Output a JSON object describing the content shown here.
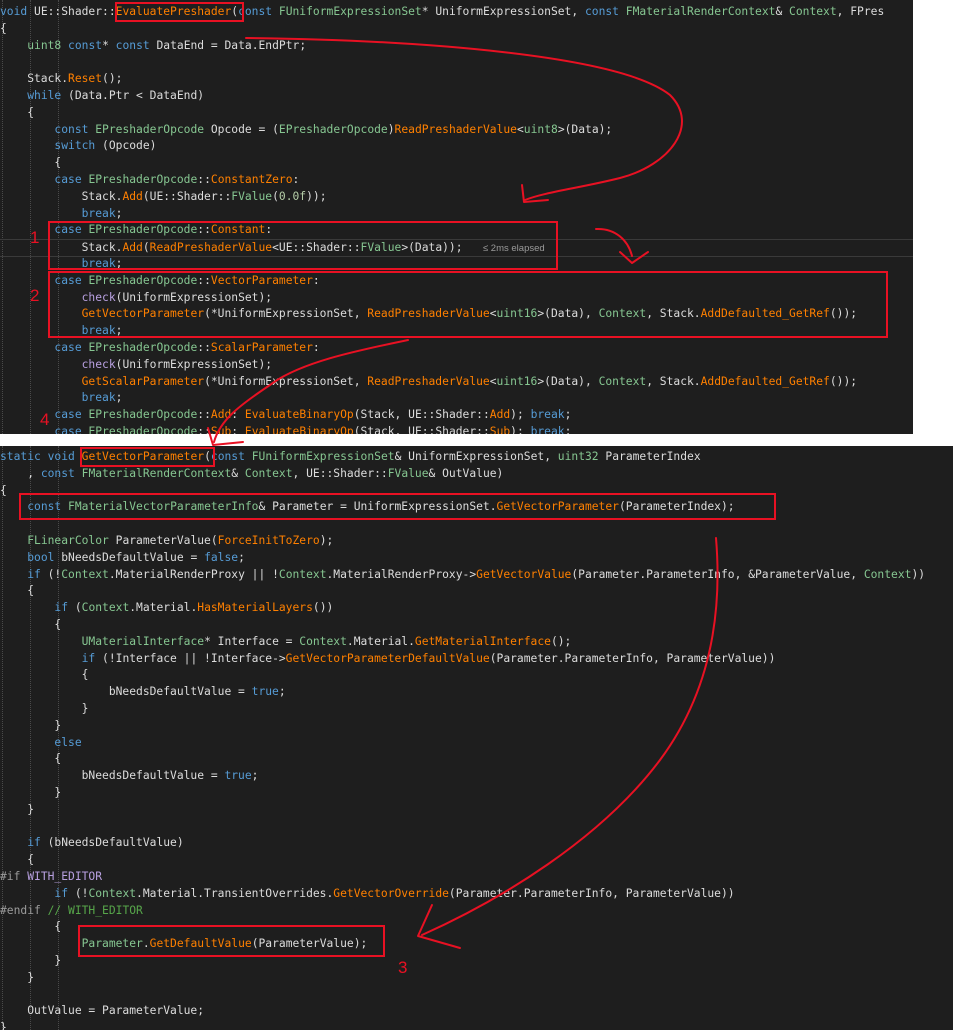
{
  "colors": {
    "default": "#dcdcdc",
    "keyword": "#569cd6",
    "type": "#4ec9b0",
    "struct": "#86c691",
    "func": "#ff8000",
    "macro": "#b8a0e0",
    "numeric": "#b5cea8",
    "comment": "#57a64a",
    "prep": "#9b9b9b",
    "param": "#9a9a9a",
    "annotation": "#e81123"
  },
  "top_editor": {
    "elapsed_hint": "≤ 2ms elapsed",
    "lines": [
      [
        [
          "void",
          "keyword"
        ],
        [
          " UE::Shader::",
          "default"
        ],
        [
          "EvaluatePreshader",
          "func"
        ],
        [
          "(",
          "default"
        ],
        [
          "const",
          "keyword"
        ],
        [
          " ",
          "default"
        ],
        [
          "FUniformExpressionSet",
          "struct"
        ],
        [
          "* UniformExpressionSet, ",
          "default"
        ],
        [
          "const",
          "keyword"
        ],
        [
          " ",
          "default"
        ],
        [
          "FMaterialRenderContext",
          "struct"
        ],
        [
          "& ",
          "default"
        ],
        [
          "Context",
          "struct"
        ],
        [
          ", FPres",
          "default"
        ]
      ],
      [
        [
          "{",
          "default"
        ]
      ],
      [
        [
          "    ",
          "default"
        ],
        [
          "uint8",
          "struct"
        ],
        [
          " ",
          "default"
        ],
        [
          "const",
          "keyword"
        ],
        [
          "* ",
          "default"
        ],
        [
          "const",
          "keyword"
        ],
        [
          " DataEnd = Data.EndPtr;",
          "default"
        ]
      ],
      [
        [
          "",
          "default"
        ]
      ],
      [
        [
          "    Stack.",
          "default"
        ],
        [
          "Reset",
          "func"
        ],
        [
          "();",
          "default"
        ]
      ],
      [
        [
          "    ",
          "default"
        ],
        [
          "while",
          "keyword"
        ],
        [
          " (Data.Ptr < DataEnd)",
          "default"
        ]
      ],
      [
        [
          "    {",
          "default"
        ]
      ],
      [
        [
          "        ",
          "default"
        ],
        [
          "const",
          "keyword"
        ],
        [
          " ",
          "default"
        ],
        [
          "EPreshaderOpcode",
          "struct"
        ],
        [
          " Opcode = (",
          "default"
        ],
        [
          "EPreshaderOpcode",
          "struct"
        ],
        [
          ")",
          "default"
        ],
        [
          "ReadPreshaderValue",
          "func"
        ],
        [
          "<",
          "default"
        ],
        [
          "uint8",
          "struct"
        ],
        [
          ">(Data);",
          "default"
        ]
      ],
      [
        [
          "        ",
          "default"
        ],
        [
          "switch",
          "keyword"
        ],
        [
          " (Opcode)",
          "default"
        ]
      ],
      [
        [
          "        {",
          "default"
        ]
      ],
      [
        [
          "        ",
          "default"
        ],
        [
          "case",
          "keyword"
        ],
        [
          " ",
          "default"
        ],
        [
          "EPreshaderOpcode",
          "struct"
        ],
        [
          "::",
          "default"
        ],
        [
          "ConstantZero",
          "func"
        ],
        [
          ":",
          "default"
        ]
      ],
      [
        [
          "            Stack.",
          "default"
        ],
        [
          "Add",
          "func"
        ],
        [
          "(UE::Shader::",
          "default"
        ],
        [
          "FValue",
          "struct"
        ],
        [
          "(",
          "default"
        ],
        [
          "0.0f",
          "numeric"
        ],
        [
          "));",
          "default"
        ]
      ],
      [
        [
          "            ",
          "default"
        ],
        [
          "break",
          "keyword"
        ],
        [
          ";",
          "default"
        ]
      ],
      [
        [
          "        ",
          "default"
        ],
        [
          "case",
          "keyword"
        ],
        [
          " ",
          "default"
        ],
        [
          "EPreshaderOpcode",
          "struct"
        ],
        [
          "::",
          "default"
        ],
        [
          "Constant",
          "func"
        ],
        [
          ":",
          "default"
        ]
      ],
      [
        [
          "            Stack.",
          "default"
        ],
        [
          "Add",
          "func"
        ],
        [
          "(",
          "default"
        ],
        [
          "ReadPreshaderValue",
          "func"
        ],
        [
          "<UE::Shader::",
          "default"
        ],
        [
          "FValue",
          "struct"
        ],
        [
          ">(Data)); ",
          "default"
        ],
        [
          "  ",
          "default"
        ]
      ],
      [
        [
          "            ",
          "default"
        ],
        [
          "break",
          "keyword"
        ],
        [
          ";",
          "default"
        ]
      ],
      [
        [
          "        ",
          "default"
        ],
        [
          "case",
          "keyword"
        ],
        [
          " ",
          "default"
        ],
        [
          "EPreshaderOpcode",
          "struct"
        ],
        [
          "::",
          "default"
        ],
        [
          "VectorParameter",
          "func"
        ],
        [
          ":",
          "default"
        ]
      ],
      [
        [
          "            ",
          "default"
        ],
        [
          "check",
          "macro"
        ],
        [
          "(UniformExpressionSet);",
          "default"
        ]
      ],
      [
        [
          "            ",
          "default"
        ],
        [
          "GetVectorParameter",
          "func"
        ],
        [
          "(*UniformExpressionSet, ",
          "default"
        ],
        [
          "ReadPreshaderValue",
          "func"
        ],
        [
          "<",
          "default"
        ],
        [
          "uint16",
          "struct"
        ],
        [
          ">(Data), ",
          "default"
        ],
        [
          "Context",
          "struct"
        ],
        [
          ", Stack.",
          "default"
        ],
        [
          "AddDefaulted_GetRef",
          "func"
        ],
        [
          "());",
          "default"
        ]
      ],
      [
        [
          "            ",
          "default"
        ],
        [
          "break",
          "keyword"
        ],
        [
          ";",
          "default"
        ]
      ],
      [
        [
          "        ",
          "default"
        ],
        [
          "case",
          "keyword"
        ],
        [
          " ",
          "default"
        ],
        [
          "EPreshaderOpcode",
          "struct"
        ],
        [
          "::",
          "default"
        ],
        [
          "ScalarParameter",
          "func"
        ],
        [
          ":",
          "default"
        ]
      ],
      [
        [
          "            ",
          "default"
        ],
        [
          "check",
          "macro"
        ],
        [
          "(UniformExpressionSet);",
          "default"
        ]
      ],
      [
        [
          "            ",
          "default"
        ],
        [
          "GetScalarParameter",
          "func"
        ],
        [
          "(*UniformExpressionSet, ",
          "default"
        ],
        [
          "ReadPreshaderValue",
          "func"
        ],
        [
          "<",
          "default"
        ],
        [
          "uint16",
          "struct"
        ],
        [
          ">(Data), ",
          "default"
        ],
        [
          "Context",
          "struct"
        ],
        [
          ", Stack.",
          "default"
        ],
        [
          "AddDefaulted_GetRef",
          "func"
        ],
        [
          "());",
          "default"
        ]
      ],
      [
        [
          "            ",
          "default"
        ],
        [
          "break",
          "keyword"
        ],
        [
          ";",
          "default"
        ]
      ],
      [
        [
          "        ",
          "default"
        ],
        [
          "case",
          "keyword"
        ],
        [
          " ",
          "default"
        ],
        [
          "EPreshaderOpcode",
          "struct"
        ],
        [
          "::",
          "default"
        ],
        [
          "Add",
          "func"
        ],
        [
          ": ",
          "default"
        ],
        [
          "EvaluateBinaryOp",
          "func"
        ],
        [
          "(Stack, UE::Shader::",
          "default"
        ],
        [
          "Add",
          "func"
        ],
        [
          "); ",
          "default"
        ],
        [
          "break",
          "keyword"
        ],
        [
          ";",
          "default"
        ]
      ],
      [
        [
          "        ",
          "default"
        ],
        [
          "case",
          "keyword"
        ],
        [
          " ",
          "default"
        ],
        [
          "EPreshaderOpcode",
          "struct"
        ],
        [
          "::",
          "default"
        ],
        [
          "Sub",
          "func"
        ],
        [
          ": ",
          "default"
        ],
        [
          "EvaluateBinaryOp",
          "func"
        ],
        [
          "(Stack, UE::Shader::",
          "default"
        ],
        [
          "Sub",
          "func"
        ],
        [
          "); ",
          "default"
        ],
        [
          "break",
          "keyword"
        ],
        [
          ";",
          "default"
        ]
      ]
    ]
  },
  "bottom_editor": {
    "lines": [
      [
        [
          "static",
          "keyword"
        ],
        [
          " ",
          "default"
        ],
        [
          "void",
          "keyword"
        ],
        [
          " ",
          "default"
        ],
        [
          "GetVectorParameter",
          "func"
        ],
        [
          "(",
          "default"
        ],
        [
          "const",
          "keyword"
        ],
        [
          " ",
          "default"
        ],
        [
          "FUniformExpressionSet",
          "struct"
        ],
        [
          "& UniformExpressionSet, ",
          "default"
        ],
        [
          "uint32",
          "struct"
        ],
        [
          " ParameterIndex",
          "default"
        ]
      ],
      [
        [
          "    , ",
          "default"
        ],
        [
          "const",
          "keyword"
        ],
        [
          " ",
          "default"
        ],
        [
          "FMaterialRenderContext",
          "struct"
        ],
        [
          "& ",
          "default"
        ],
        [
          "Context",
          "struct"
        ],
        [
          ", UE::Shader::",
          "default"
        ],
        [
          "FValue",
          "struct"
        ],
        [
          "& OutValue)",
          "default"
        ]
      ],
      [
        [
          "{",
          "default"
        ]
      ],
      [
        [
          "    ",
          "default"
        ],
        [
          "const",
          "keyword"
        ],
        [
          " ",
          "default"
        ],
        [
          "FMaterialVectorParameterInfo",
          "struct"
        ],
        [
          "& Parameter = UniformExpressionSet.",
          "default"
        ],
        [
          "GetVectorParameter",
          "func"
        ],
        [
          "(ParameterIndex);",
          "default"
        ]
      ],
      [
        [
          "",
          "default"
        ]
      ],
      [
        [
          "    ",
          "default"
        ],
        [
          "FLinearColor",
          "struct"
        ],
        [
          " ParameterValue(",
          "default"
        ],
        [
          "ForceInitToZero",
          "func"
        ],
        [
          ");",
          "default"
        ]
      ],
      [
        [
          "    ",
          "default"
        ],
        [
          "bool",
          "keyword"
        ],
        [
          " bNeedsDefaultValue = ",
          "default"
        ],
        [
          "false",
          "keyword"
        ],
        [
          ";",
          "default"
        ]
      ],
      [
        [
          "    ",
          "default"
        ],
        [
          "if",
          "keyword"
        ],
        [
          " (!",
          "default"
        ],
        [
          "Context",
          "struct"
        ],
        [
          ".MaterialRenderProxy || !",
          "default"
        ],
        [
          "Context",
          "struct"
        ],
        [
          ".MaterialRenderProxy->",
          "default"
        ],
        [
          "GetVectorValue",
          "func"
        ],
        [
          "(Parameter.ParameterInfo, &ParameterValue, ",
          "default"
        ],
        [
          "Context",
          "struct"
        ],
        [
          "))",
          "default"
        ]
      ],
      [
        [
          "    {",
          "default"
        ]
      ],
      [
        [
          "        ",
          "default"
        ],
        [
          "if",
          "keyword"
        ],
        [
          " (",
          "default"
        ],
        [
          "Context",
          "struct"
        ],
        [
          ".Material.",
          "default"
        ],
        [
          "HasMaterialLayers",
          "func"
        ],
        [
          "())",
          "default"
        ]
      ],
      [
        [
          "        {",
          "default"
        ]
      ],
      [
        [
          "            ",
          "default"
        ],
        [
          "UMaterialInterface",
          "struct"
        ],
        [
          "* Interface = ",
          "default"
        ],
        [
          "Context",
          "struct"
        ],
        [
          ".Material.",
          "default"
        ],
        [
          "GetMaterialInterface",
          "func"
        ],
        [
          "();",
          "default"
        ]
      ],
      [
        [
          "            ",
          "default"
        ],
        [
          "if",
          "keyword"
        ],
        [
          " (!Interface || !Interface->",
          "default"
        ],
        [
          "GetVectorParameterDefaultValue",
          "func"
        ],
        [
          "(Parameter.ParameterInfo, ParameterValue))",
          "default"
        ]
      ],
      [
        [
          "            {",
          "default"
        ]
      ],
      [
        [
          "                bNeedsDefaultValue = ",
          "default"
        ],
        [
          "true",
          "keyword"
        ],
        [
          ";",
          "default"
        ]
      ],
      [
        [
          "            }",
          "default"
        ]
      ],
      [
        [
          "        }",
          "default"
        ]
      ],
      [
        [
          "        ",
          "default"
        ],
        [
          "else",
          "keyword"
        ]
      ],
      [
        [
          "        {",
          "default"
        ]
      ],
      [
        [
          "            bNeedsDefaultValue = ",
          "default"
        ],
        [
          "true",
          "keyword"
        ],
        [
          ";",
          "default"
        ]
      ],
      [
        [
          "        }",
          "default"
        ]
      ],
      [
        [
          "    }",
          "default"
        ]
      ],
      [
        [
          "",
          "default"
        ]
      ],
      [
        [
          "    ",
          "default"
        ],
        [
          "if",
          "keyword"
        ],
        [
          " (bNeedsDefaultValue)",
          "default"
        ]
      ],
      [
        [
          "    {",
          "default"
        ]
      ],
      [
        [
          "#if",
          "prep"
        ],
        [
          " ",
          "default"
        ],
        [
          "WITH_EDITOR",
          "macro"
        ]
      ],
      [
        [
          "        ",
          "default"
        ],
        [
          "if",
          "keyword"
        ],
        [
          " (!",
          "default"
        ],
        [
          "Context",
          "struct"
        ],
        [
          ".Material.TransientOverrides.",
          "default"
        ],
        [
          "GetVectorOverride",
          "func"
        ],
        [
          "(Parameter.ParameterInfo, ParameterValue))",
          "default"
        ]
      ],
      [
        [
          "#endif",
          "prep"
        ],
        [
          " ",
          "default"
        ],
        [
          "// WITH_EDITOR",
          "comment"
        ]
      ],
      [
        [
          "        {",
          "default"
        ]
      ],
      [
        [
          "            ",
          "default"
        ],
        [
          "Parameter",
          "struct"
        ],
        [
          ".",
          "default"
        ],
        [
          "GetDefaultValue",
          "func"
        ],
        [
          "(ParameterValue);",
          "default"
        ]
      ],
      [
        [
          "        }",
          "default"
        ]
      ],
      [
        [
          "    }",
          "default"
        ]
      ],
      [
        [
          "",
          "default"
        ]
      ],
      [
        [
          "    OutValue = ParameterValue;",
          "default"
        ]
      ],
      [
        [
          "}",
          "default"
        ]
      ]
    ]
  },
  "annotations": {
    "step_1": "1",
    "step_2": "2",
    "step_3": "3",
    "step_4": "4"
  }
}
